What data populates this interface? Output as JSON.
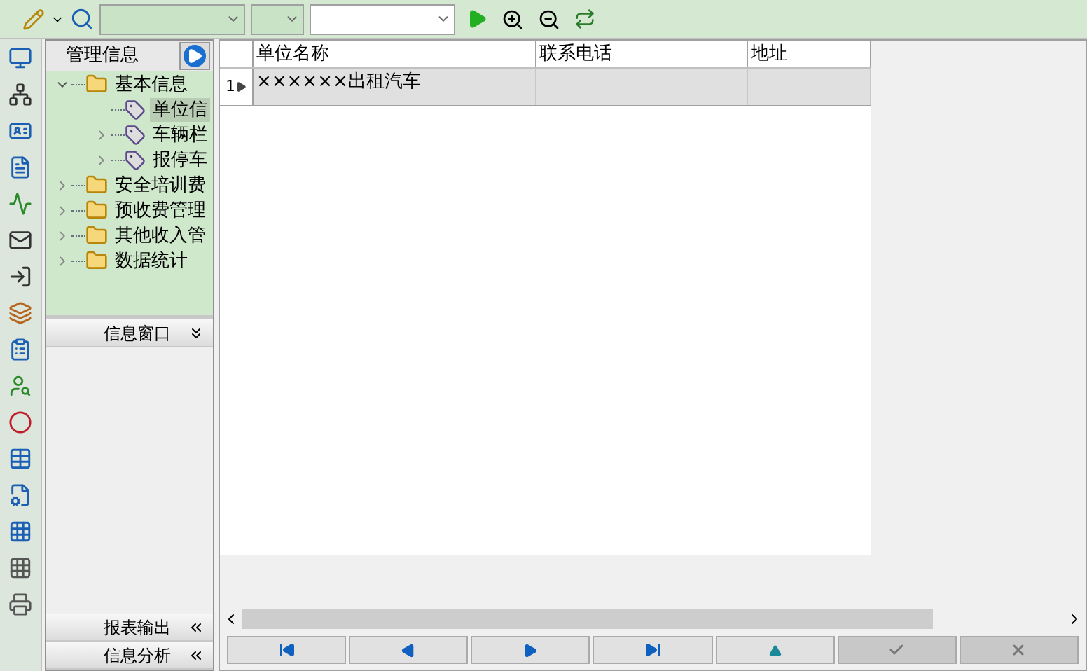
{
  "toolbar": {
    "combos": [
      {
        "enabled": false
      },
      {
        "enabled": false
      },
      {
        "enabled": true
      }
    ]
  },
  "tree_panel": {
    "title": "管理信息",
    "items": [
      {
        "label": "基本信息",
        "kind": "folder",
        "expanded": true,
        "selected": false,
        "children": [
          {
            "label": "单位信",
            "kind": "form",
            "selected": true
          },
          {
            "label": "车辆栏",
            "kind": "form",
            "expanded": false,
            "selected": false
          },
          {
            "label": "报停车",
            "kind": "form",
            "expanded": false,
            "selected": false
          }
        ]
      },
      {
        "label": "安全培训费",
        "kind": "folder",
        "expanded": false,
        "selected": false
      },
      {
        "label": "预收费管理",
        "kind": "folder",
        "expanded": false,
        "selected": false
      },
      {
        "label": "其他收入管",
        "kind": "folder",
        "expanded": false,
        "selected": false
      },
      {
        "label": "数据统计",
        "kind": "folder",
        "expanded": false,
        "selected": false
      }
    ]
  },
  "panels": [
    {
      "title": "信息窗口",
      "expanded": true
    },
    {
      "title": "报表输出",
      "expanded": false
    },
    {
      "title": "信息分析",
      "expanded": false
    }
  ],
  "table": {
    "columns": [
      "单位名称",
      "联系电话",
      "地址"
    ],
    "rows": [
      {
        "number": "1",
        "current": true,
        "cells": [
          "××××××出租汽车",
          "",
          ""
        ]
      }
    ]
  },
  "navigator": [
    {
      "kind": "first",
      "disabled": false
    },
    {
      "kind": "prior",
      "disabled": false
    },
    {
      "kind": "next",
      "disabled": false
    },
    {
      "kind": "last",
      "disabled": false
    },
    {
      "kind": "insert",
      "disabled": false
    },
    {
      "kind": "post",
      "disabled": true
    },
    {
      "kind": "cancel",
      "disabled": true
    }
  ]
}
